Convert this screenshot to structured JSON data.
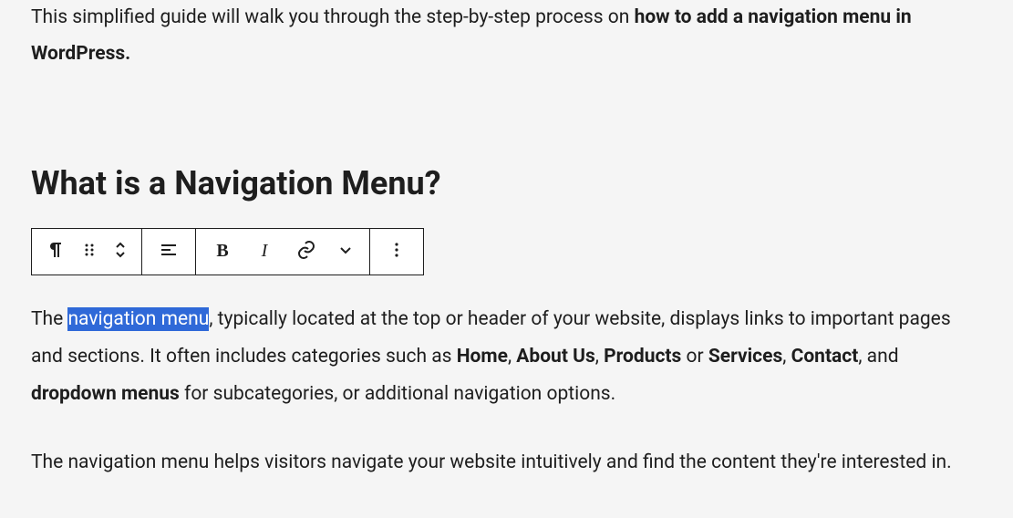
{
  "intro": {
    "prefix": "This simplified guide will walk you through the step-by-step process on ",
    "bold": "how to add a navigation menu in WordPress.",
    "suffix": ""
  },
  "heading": "What is a Navigation Menu?",
  "toolbar": {
    "icons": {
      "paragraph": "paragraph",
      "drag": "drag",
      "move": "move-up-down",
      "align": "align-left",
      "bold": "B",
      "italic": "I",
      "link": "link",
      "dropdown": "chevron-down",
      "more": "more-vertical"
    }
  },
  "p1": {
    "t1": "The ",
    "highlight": "navigation menu",
    "t2": ", typically located at the top or header of your website, displays links to important pages and sections. It often includes categories such as ",
    "b1": "Home",
    "t3": ", ",
    "b2": "About Us",
    "t4": ", ",
    "b3": "Products",
    "t5": " or ",
    "b4": "Services",
    "t6": ", ",
    "b5": "Contact",
    "t7": ", and ",
    "b6": "dropdown menus",
    "t8": " for subcategories, or additional navigation options."
  },
  "p2": "The navigation menu helps visitors navigate your website intuitively and find the content they're interested in."
}
